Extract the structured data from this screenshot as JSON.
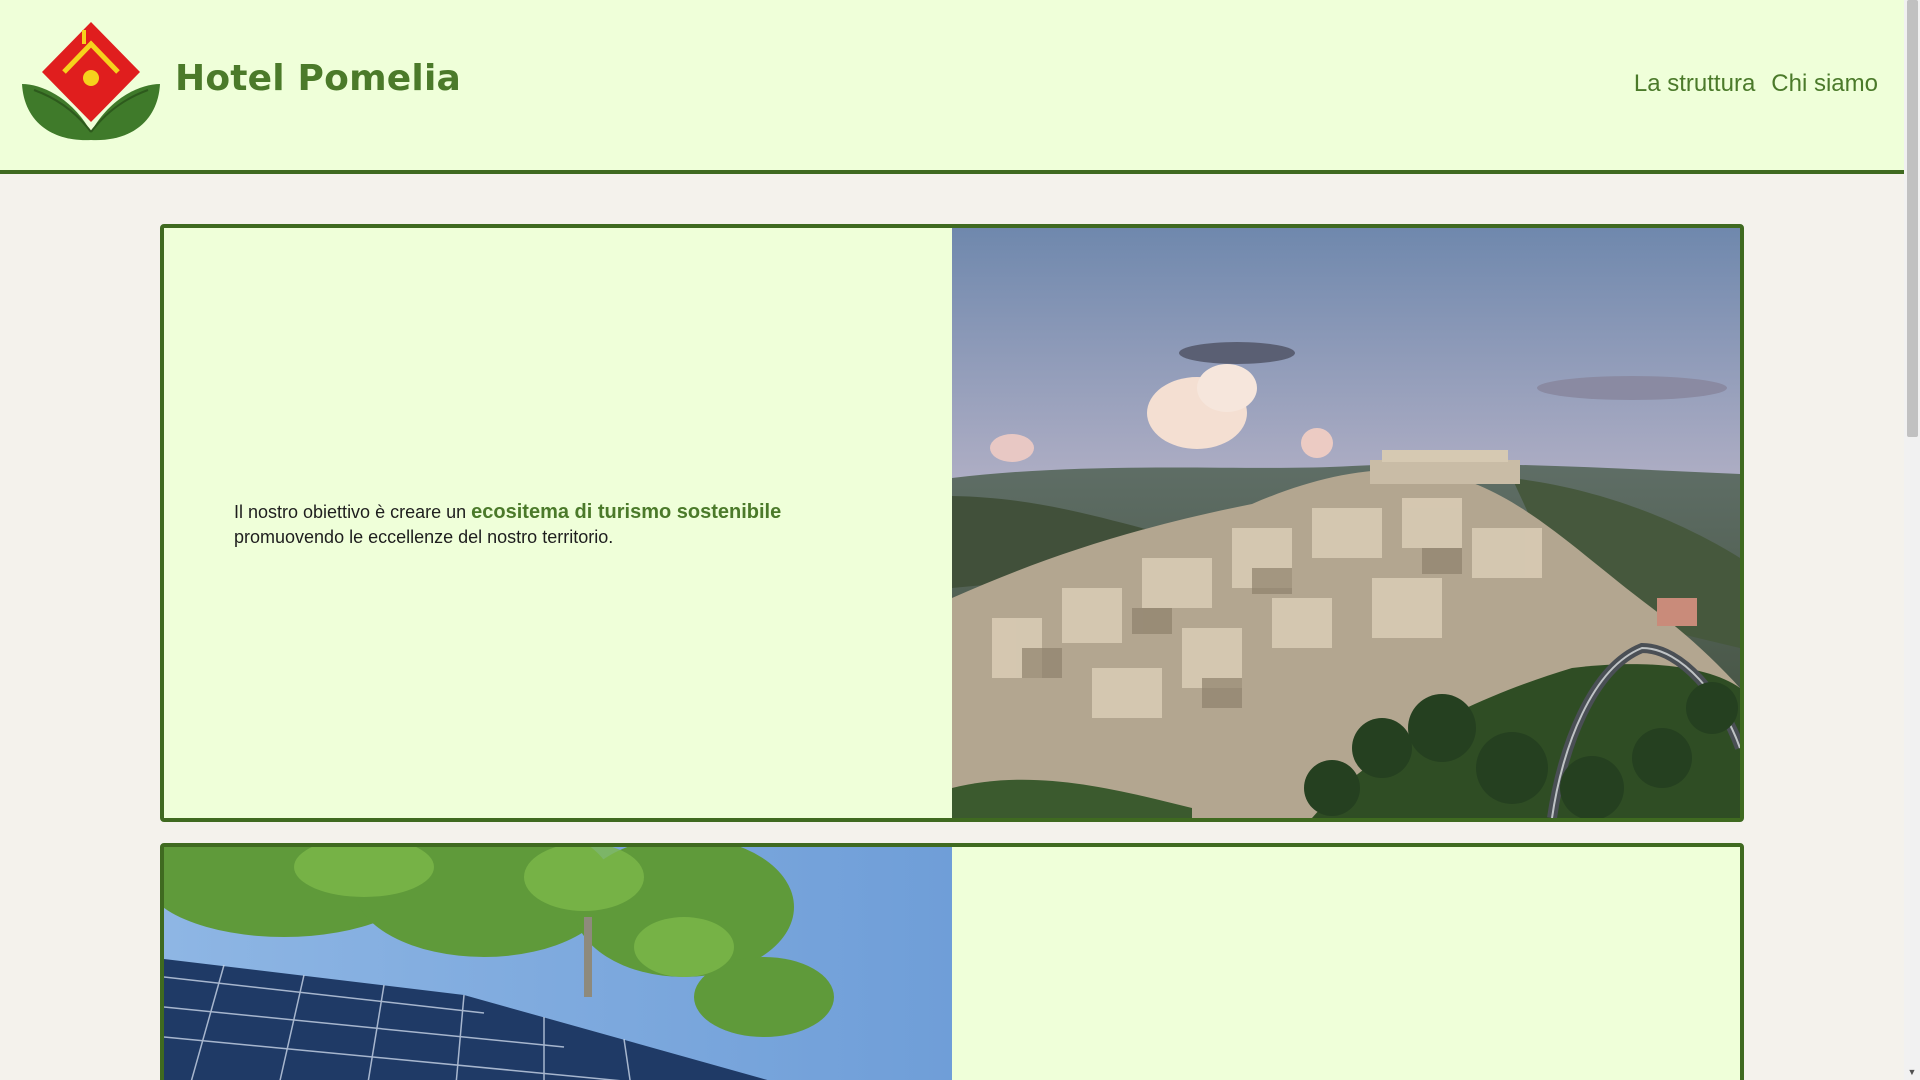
{
  "header": {
    "brand": "Hotel Pomelia",
    "nav": [
      "La struttura",
      "Chi siamo"
    ]
  },
  "section1": {
    "text_before": "Il nostro obiettivo è creare un ",
    "highlight": "ecositema di turismo sostenibile",
    "text_after": "promuovendo le eccellenze del nostro territorio."
  },
  "colors": {
    "brand_green": "#4b7a2a",
    "border_green": "#3f6a20",
    "panel_bg": "#efffd9",
    "page_bg": "#f4f2ec"
  },
  "scrollbar": {
    "down_arrow": "▼"
  }
}
